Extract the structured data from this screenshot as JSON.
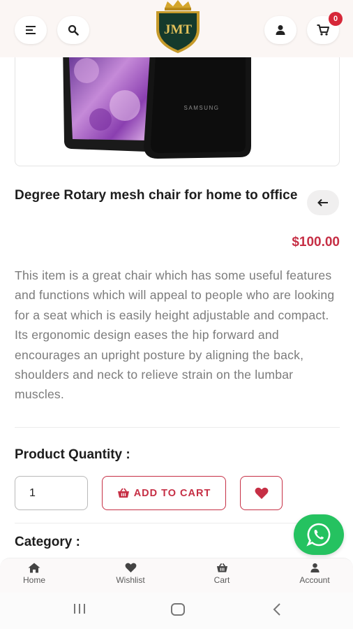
{
  "header": {
    "logo_text": "JMT",
    "cart_count": "0",
    "icons": [
      "menu-icon",
      "search-icon",
      "user-icon",
      "cart-icon"
    ]
  },
  "product": {
    "image_brand_text": "SAMSUNG",
    "title": "Degree Rotary mesh chair for home to office",
    "price": "$100.00",
    "description": "This item is a great chair which has some useful features and functions which will appeal to people who are looking for a seat which is easily height adjustable and compact. Its ergonomic design eases the hip forward and encourages an upright posture by aligning the back, shoulders and neck to relieve strain on the lumbar muscles."
  },
  "quantity": {
    "label": "Product Quantity :",
    "value": "1"
  },
  "actions": {
    "add_to_cart_label": "ADD TO CART"
  },
  "category": {
    "label": "Category :"
  },
  "bottom_nav": {
    "items": [
      {
        "label": "Home",
        "icon": "home-icon"
      },
      {
        "label": "Wishlist",
        "icon": "heart-icon"
      },
      {
        "label": "Cart",
        "icon": "basket-icon"
      },
      {
        "label": "Account",
        "icon": "user-icon"
      }
    ]
  },
  "colors": {
    "accent": "#c62f45",
    "whatsapp": "#25c260",
    "header_bg": "#fbf6f4",
    "description_text": "#7b7b7b"
  }
}
